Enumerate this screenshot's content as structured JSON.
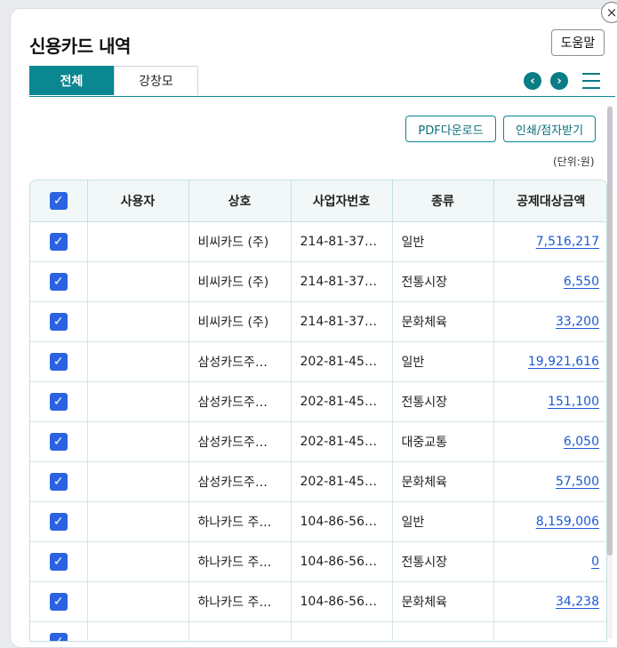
{
  "dialog": {
    "title": "신용카드 내역",
    "help_label": "도움말",
    "close_icon": "×"
  },
  "tabs": [
    {
      "label": "전체",
      "active": true
    },
    {
      "label": "강창모",
      "active": false
    }
  ],
  "nav": {
    "prev_icon": "‹",
    "next_icon": "›",
    "menu_icon": "hamburger-menu"
  },
  "actions": {
    "pdf_label": "PDF다운로드",
    "print_label": "인쇄/점자받기"
  },
  "unit_label": "(단위:원)",
  "colors": {
    "accent": "#0b8791",
    "checkbox": "#2b63e0",
    "amount_link": "#1d5bd6"
  },
  "table": {
    "columns": [
      "사용자",
      "상호",
      "사업자번호",
      "종류",
      "공제대상금액"
    ],
    "rows": [
      {
        "checked": true,
        "user": "",
        "name": "비씨카드 (주)",
        "biz": "214-81-37…",
        "type": "일반",
        "amount": "7,516,217"
      },
      {
        "checked": true,
        "user": "",
        "name": "비씨카드 (주)",
        "biz": "214-81-37…",
        "type": "전통시장",
        "amount": "6,550"
      },
      {
        "checked": true,
        "user": "",
        "name": "비씨카드 (주)",
        "biz": "214-81-37…",
        "type": "문화체육",
        "amount": "33,200"
      },
      {
        "checked": true,
        "user": "",
        "name": "삼성카드주…",
        "biz": "202-81-45…",
        "type": "일반",
        "amount": "19,921,616"
      },
      {
        "checked": true,
        "user": "",
        "name": "삼성카드주…",
        "biz": "202-81-45…",
        "type": "전통시장",
        "amount": "151,100"
      },
      {
        "checked": true,
        "user": "",
        "name": "삼성카드주…",
        "biz": "202-81-45…",
        "type": "대중교통",
        "amount": "6,050"
      },
      {
        "checked": true,
        "user": "",
        "name": "삼성카드주…",
        "biz": "202-81-45…",
        "type": "문화체육",
        "amount": "57,500"
      },
      {
        "checked": true,
        "user": "",
        "name": "하나카드 주…",
        "biz": "104-86-56…",
        "type": "일반",
        "amount": "8,159,006"
      },
      {
        "checked": true,
        "user": "",
        "name": "하나카드 주…",
        "biz": "104-86-56…",
        "type": "전통시장",
        "amount": "0"
      },
      {
        "checked": true,
        "user": "",
        "name": "하나카드 주…",
        "biz": "104-86-56…",
        "type": "문화체육",
        "amount": "34,238"
      },
      {
        "checked": true,
        "user": "",
        "name": "",
        "biz": "",
        "type": "",
        "amount": ""
      }
    ]
  }
}
